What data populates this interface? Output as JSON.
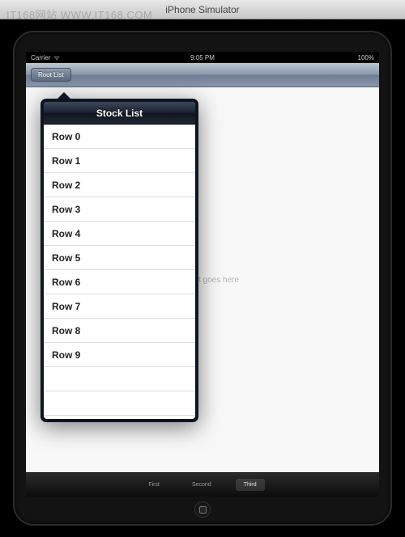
{
  "watermark": "IT168网站 WWW.IT168.COM",
  "window": {
    "title": "iPhone Simulator"
  },
  "statusbar": {
    "carrier": "Carrier",
    "time": "9:05 PM",
    "battery": "100%"
  },
  "navbar": {
    "button_label": "Root List"
  },
  "popover": {
    "title": "Stock List",
    "rows": [
      "Row 0",
      "Row 1",
      "Row 2",
      "Row 3",
      "Row 4",
      "Row 5",
      "Row 6",
      "Row 7",
      "Row 8",
      "Row 9"
    ]
  },
  "content": {
    "placeholder": "w content goes here"
  },
  "tabs": {
    "items": [
      "First",
      "Second",
      "Third"
    ],
    "selected_index": 2
  }
}
